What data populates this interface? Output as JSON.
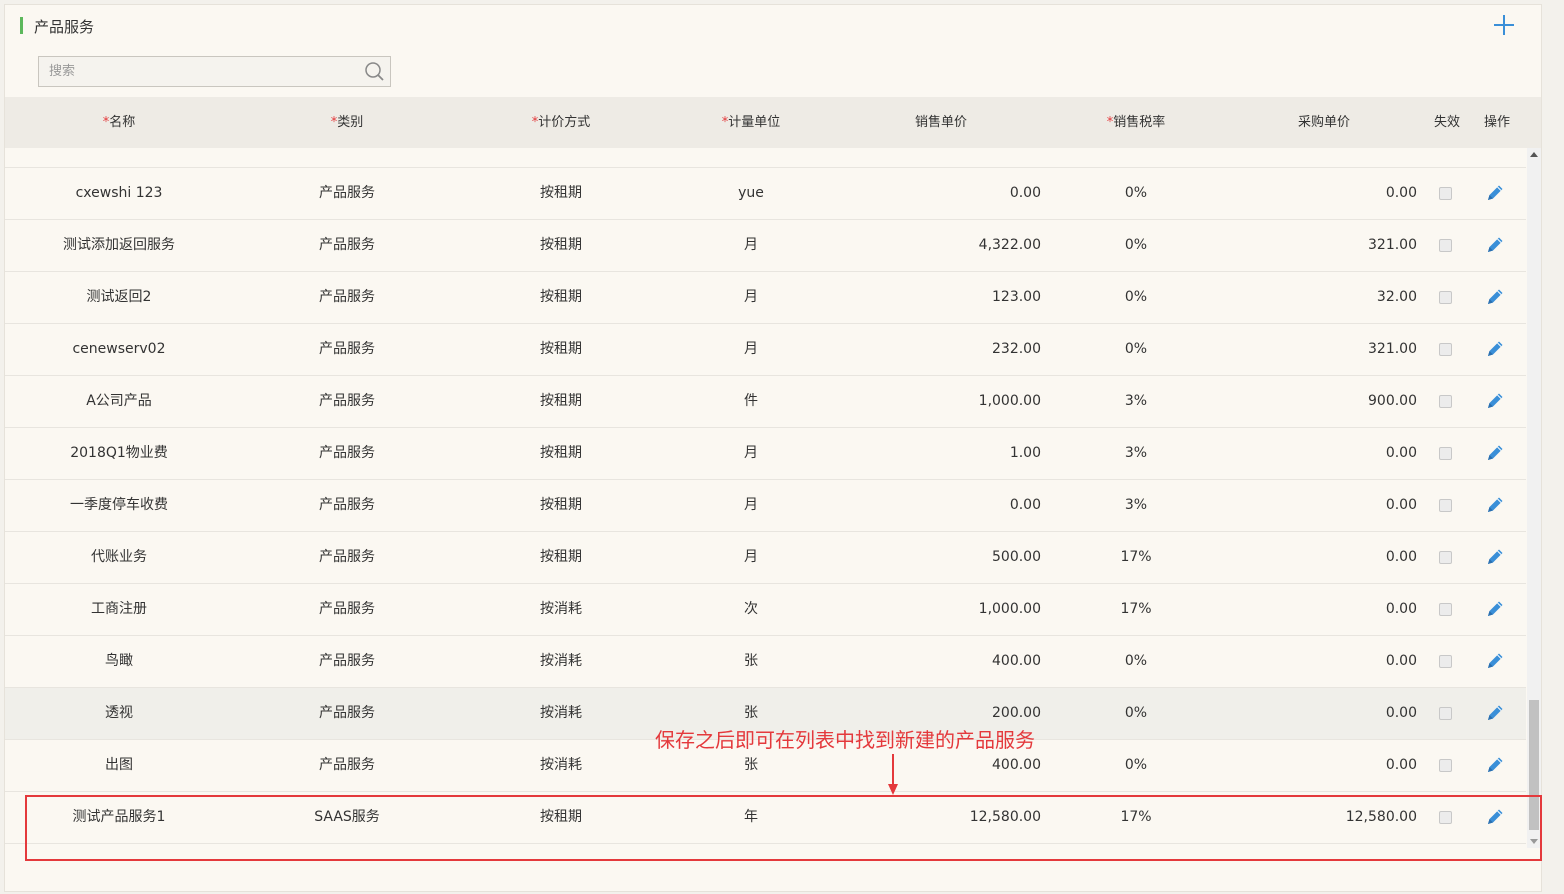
{
  "header": {
    "title": "产品服务",
    "add_label": "+"
  },
  "search": {
    "placeholder": "搜索",
    "value": ""
  },
  "columns": [
    {
      "label": "名称",
      "required": true
    },
    {
      "label": "类别",
      "required": true
    },
    {
      "label": "计价方式",
      "required": true
    },
    {
      "label": "计量单位",
      "required": true
    },
    {
      "label": "销售单价",
      "required": false
    },
    {
      "label": "销售税率",
      "required": true
    },
    {
      "label": "采购单价",
      "required": false
    },
    {
      "label": "失效",
      "required": false
    },
    {
      "label": "操作",
      "required": false
    }
  ],
  "required_mark": "*",
  "rows": [
    {
      "name": "cxewshi 123",
      "category": "产品服务",
      "pricing": "按租期",
      "unit": "yue",
      "sale_price": "0.00",
      "tax_rate": "0%",
      "purchase_price": "0.00",
      "disabled": false
    },
    {
      "name": "测试添加返回服务",
      "category": "产品服务",
      "pricing": "按租期",
      "unit": "月",
      "sale_price": "4,322.00",
      "tax_rate": "0%",
      "purchase_price": "321.00",
      "disabled": false
    },
    {
      "name": "测试返回2",
      "category": "产品服务",
      "pricing": "按租期",
      "unit": "月",
      "sale_price": "123.00",
      "tax_rate": "0%",
      "purchase_price": "32.00",
      "disabled": false
    },
    {
      "name": "cenewserv02",
      "category": "产品服务",
      "pricing": "按租期",
      "unit": "月",
      "sale_price": "232.00",
      "tax_rate": "0%",
      "purchase_price": "321.00",
      "disabled": false
    },
    {
      "name": "A公司产品",
      "category": "产品服务",
      "pricing": "按租期",
      "unit": "件",
      "sale_price": "1,000.00",
      "tax_rate": "3%",
      "purchase_price": "900.00",
      "disabled": false
    },
    {
      "name": "2018Q1物业费",
      "category": "产品服务",
      "pricing": "按租期",
      "unit": "月",
      "sale_price": "1.00",
      "tax_rate": "3%",
      "purchase_price": "0.00",
      "disabled": false
    },
    {
      "name": "一季度停车收费",
      "category": "产品服务",
      "pricing": "按租期",
      "unit": "月",
      "sale_price": "0.00",
      "tax_rate": "3%",
      "purchase_price": "0.00",
      "disabled": false
    },
    {
      "name": "代账业务",
      "category": "产品服务",
      "pricing": "按租期",
      "unit": "月",
      "sale_price": "500.00",
      "tax_rate": "17%",
      "purchase_price": "0.00",
      "disabled": false
    },
    {
      "name": "工商注册",
      "category": "产品服务",
      "pricing": "按消耗",
      "unit": "次",
      "sale_price": "1,000.00",
      "tax_rate": "17%",
      "purchase_price": "0.00",
      "disabled": false
    },
    {
      "name": "鸟瞰",
      "category": "产品服务",
      "pricing": "按消耗",
      "unit": "张",
      "sale_price": "400.00",
      "tax_rate": "0%",
      "purchase_price": "0.00",
      "disabled": false
    },
    {
      "name": "透视",
      "category": "产品服务",
      "pricing": "按消耗",
      "unit": "张",
      "sale_price": "200.00",
      "tax_rate": "0%",
      "purchase_price": "0.00",
      "disabled": false
    },
    {
      "name": "出图",
      "category": "产品服务",
      "pricing": "按消耗",
      "unit": "张",
      "sale_price": "400.00",
      "tax_rate": "0%",
      "purchase_price": "0.00",
      "disabled": false
    },
    {
      "name": "测试产品服务1",
      "category": "SAAS服务",
      "pricing": "按租期",
      "unit": "年",
      "sale_price": "12,580.00",
      "tax_rate": "17%",
      "purchase_price": "12,580.00",
      "disabled": false
    }
  ],
  "highlighted_row_index": 10,
  "annotation": {
    "text": "保存之后即可在列表中找到新建的产品服务",
    "color": "#e4393c"
  },
  "colors": {
    "accent_green": "#5cb85c",
    "edit_blue": "#3a8fd8",
    "required_red": "#e4393c"
  },
  "icons": {
    "add": "plus-icon",
    "search": "search-icon",
    "edit": "pencil-icon"
  }
}
